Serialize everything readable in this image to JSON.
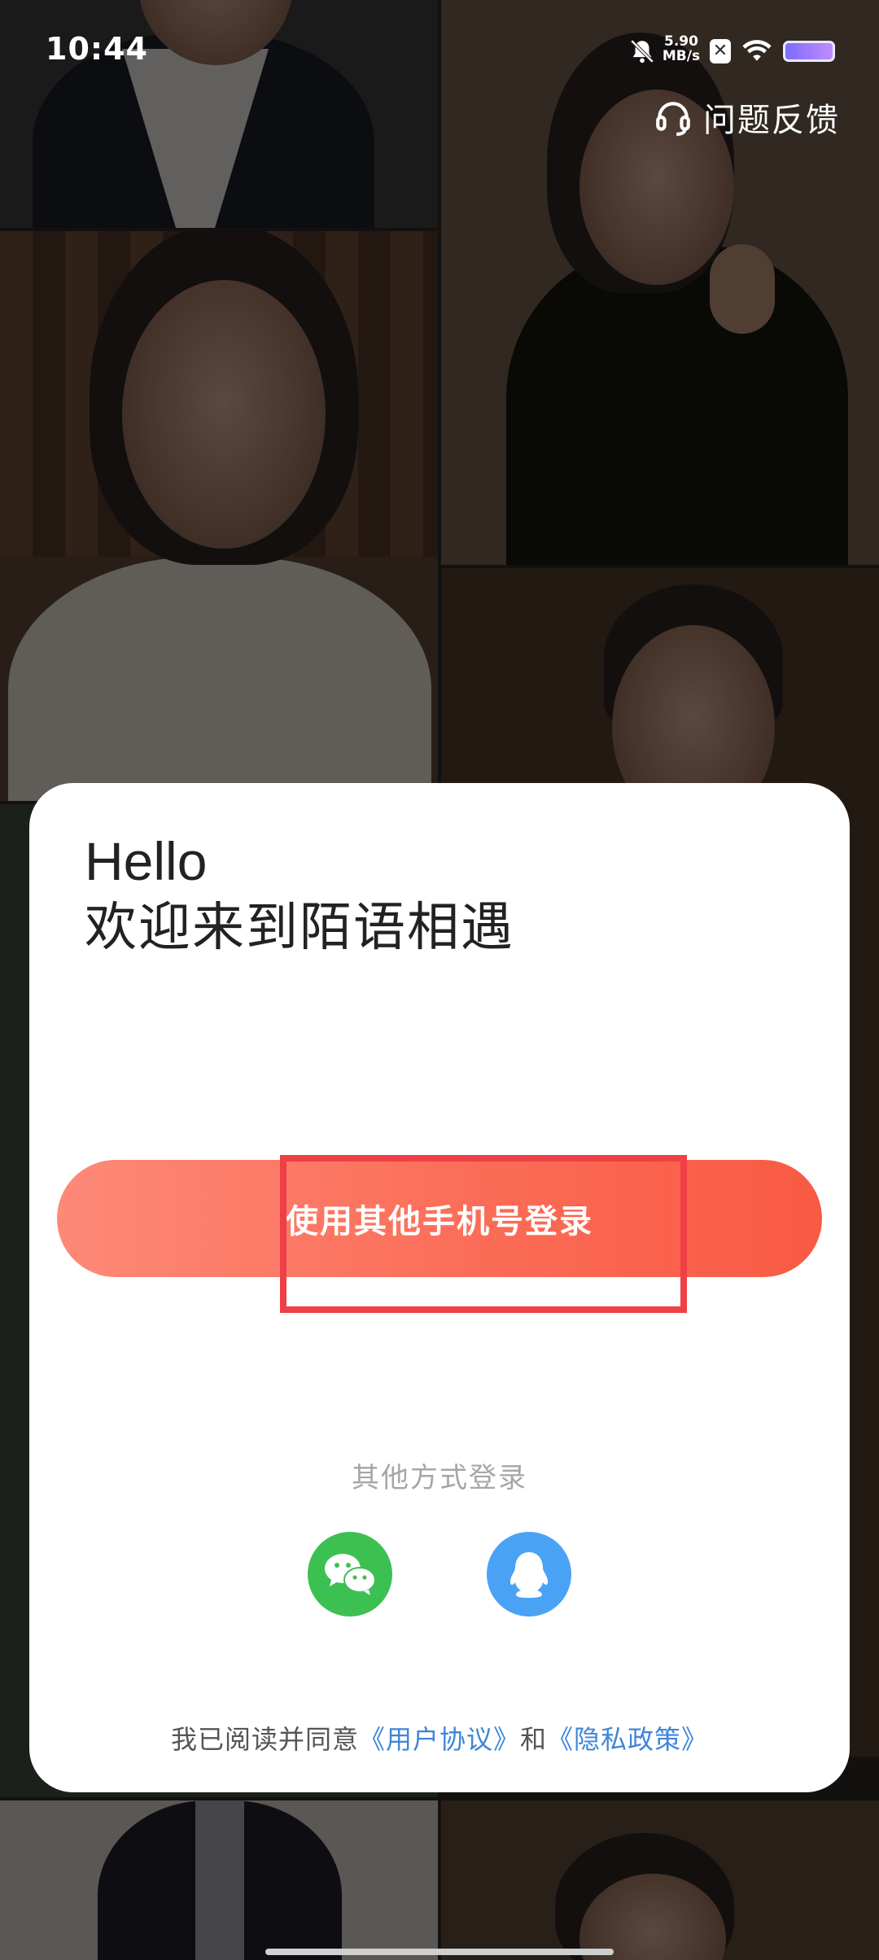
{
  "status_bar": {
    "time": "10:44",
    "network_speed_value": "5.90",
    "network_speed_unit": "MB/s",
    "x_badge": "✕"
  },
  "header": {
    "feedback_label": "问题反馈",
    "feedback_icon": "headset-icon"
  },
  "card": {
    "hello": "Hello",
    "welcome": "欢迎来到陌语相遇",
    "phone_login_label": "使用其他手机号登录",
    "other_methods_label": "其他方式登录",
    "social": [
      {
        "name": "wechat",
        "icon": "wechat-icon",
        "color": "#3dc052"
      },
      {
        "name": "qq",
        "icon": "qq-icon",
        "color": "#4aa2f5"
      }
    ],
    "agreement": {
      "prefix": "我已阅读并同意",
      "user_agreement": "《用户协议》",
      "conjunction": "和",
      "privacy_policy": "《隐私政策》"
    }
  },
  "colors": {
    "accent_start": "#fd8977",
    "accent_end": "#f85a43",
    "highlight": "#ee4046",
    "link": "#3e86d8"
  }
}
